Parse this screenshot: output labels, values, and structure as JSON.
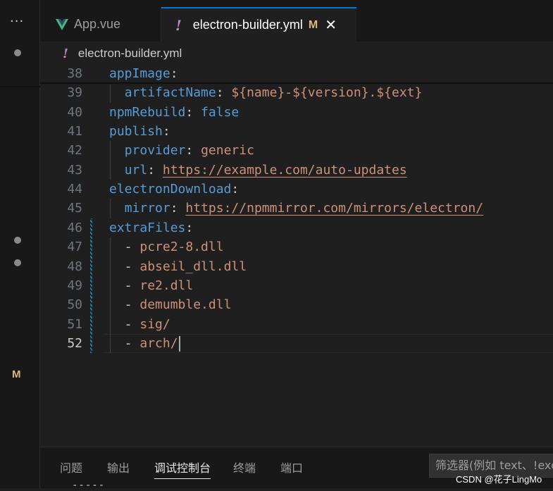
{
  "activity_bar": {
    "more_label": "···",
    "modified_flag": "M"
  },
  "tabs": [
    {
      "label": "App.vue",
      "icon": "vue-icon",
      "active": false
    },
    {
      "label": "electron-builder.yml",
      "icon": "yaml-icon",
      "icon_glyph": "!",
      "modified": "M",
      "close": "✕",
      "active": true
    }
  ],
  "breadcrumb": {
    "icon_glyph": "!",
    "file": "electron-builder.yml"
  },
  "editor": {
    "lines": [
      {
        "n": "38",
        "tokens": [
          [
            "k",
            "appImage"
          ],
          [
            "p",
            ":"
          ]
        ]
      },
      {
        "n": "39",
        "tokens": [
          [
            "p",
            "  "
          ],
          [
            "k",
            "artifactName"
          ],
          [
            "p",
            ": "
          ],
          [
            "s",
            "${name}-${version}.${ext}"
          ]
        ]
      },
      {
        "n": "40",
        "tokens": [
          [
            "k",
            "npmRebuild"
          ],
          [
            "p",
            ": "
          ],
          [
            "k",
            "false"
          ]
        ]
      },
      {
        "n": "41",
        "tokens": [
          [
            "k",
            "publish"
          ],
          [
            "p",
            ":"
          ]
        ]
      },
      {
        "n": "42",
        "tokens": [
          [
            "p",
            "  "
          ],
          [
            "k",
            "provider"
          ],
          [
            "p",
            ": "
          ],
          [
            "s",
            "generic"
          ]
        ]
      },
      {
        "n": "43",
        "tokens": [
          [
            "p",
            "  "
          ],
          [
            "k",
            "url"
          ],
          [
            "p",
            ": "
          ],
          [
            "u",
            "https://example.com/auto-updates"
          ]
        ]
      },
      {
        "n": "44",
        "tokens": [
          [
            "k",
            "electronDownload"
          ],
          [
            "p",
            ":"
          ]
        ]
      },
      {
        "n": "45",
        "tokens": [
          [
            "p",
            "  "
          ],
          [
            "k",
            "mirror"
          ],
          [
            "p",
            ": "
          ],
          [
            "u",
            "https://npmmirror.com/mirrors/electron/"
          ]
        ]
      },
      {
        "n": "46",
        "tokens": [
          [
            "k",
            "extraFiles"
          ],
          [
            "p",
            ":"
          ]
        ]
      },
      {
        "n": "47",
        "tokens": [
          [
            "p",
            "  - "
          ],
          [
            "s",
            "pcre2-8.dll"
          ]
        ]
      },
      {
        "n": "48",
        "tokens": [
          [
            "p",
            "  - "
          ],
          [
            "s",
            "abseil_dll.dll"
          ]
        ]
      },
      {
        "n": "49",
        "tokens": [
          [
            "p",
            "  - "
          ],
          [
            "s",
            "re2.dll"
          ]
        ]
      },
      {
        "n": "50",
        "tokens": [
          [
            "p",
            "  - "
          ],
          [
            "s",
            "demumble.dll"
          ]
        ]
      },
      {
        "n": "51",
        "tokens": [
          [
            "p",
            "  - "
          ],
          [
            "s",
            "sig/"
          ]
        ]
      },
      {
        "n": "52",
        "tokens": [
          [
            "p",
            "  - "
          ],
          [
            "s",
            "arch/"
          ]
        ],
        "current": true
      }
    ]
  },
  "panel": {
    "tabs": [
      "问题",
      "输出",
      "调试控制台",
      "终端",
      "端口"
    ],
    "active_tab": "调试控制台",
    "filter_placeholder": "筛选器(例如 text、!exclude",
    "dashes": "-----"
  },
  "watermark": "CSDN @花子LingMo",
  "colors": {
    "accent": "#0078d4",
    "keyword": "#569cd6",
    "string": "#ce9178",
    "modified": "#d7ba7d",
    "yaml_icon": "#c586c0"
  }
}
